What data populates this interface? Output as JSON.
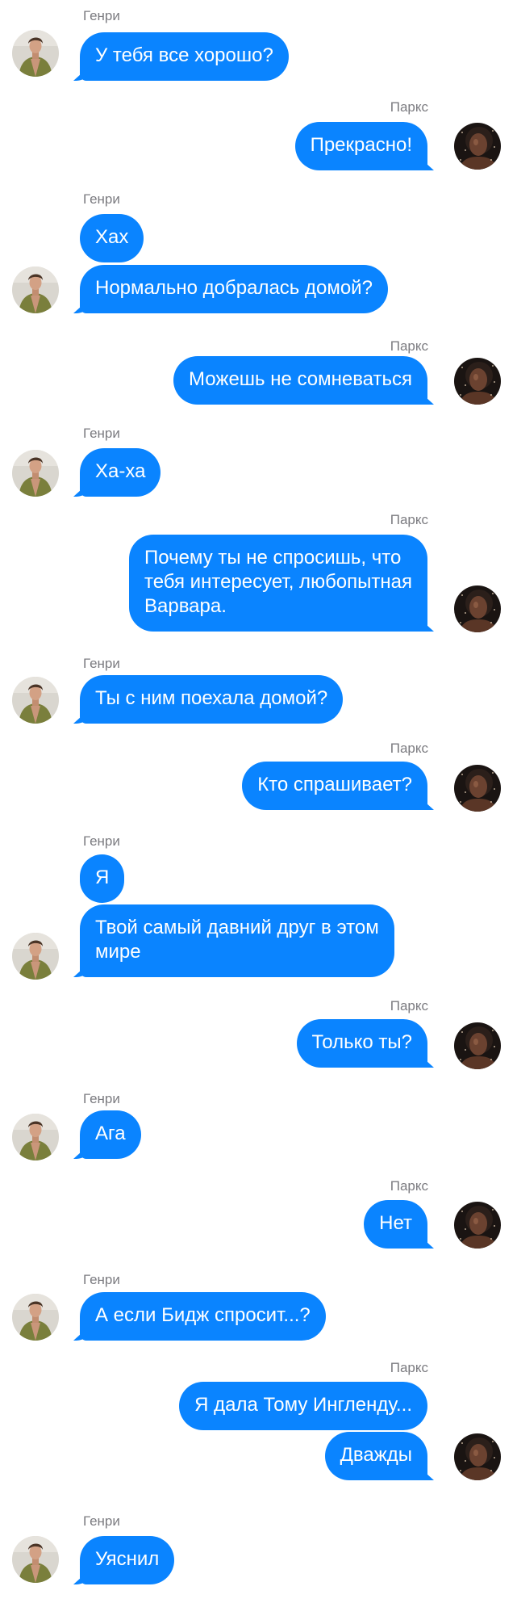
{
  "chat": {
    "messages": [
      {
        "sender": "Генри",
        "side": "left",
        "texts": [
          "У тебя все хорошо?"
        ]
      },
      {
        "sender": "Паркс",
        "side": "right",
        "texts": [
          "Прекрасно!"
        ]
      },
      {
        "sender": "Генри",
        "side": "left",
        "texts": [
          "Хах",
          "Нормально добралась домой?"
        ]
      },
      {
        "sender": "Паркс",
        "side": "right",
        "texts": [
          "Можешь не сомневаться"
        ]
      },
      {
        "sender": "Генри",
        "side": "left",
        "texts": [
          "Ха-ха"
        ]
      },
      {
        "sender": "Паркс",
        "side": "right",
        "texts": [
          "Почему ты не спросишь, что\nтебя интересует, любопытная\nВарвара."
        ]
      },
      {
        "sender": "Генри",
        "side": "left",
        "texts": [
          "Ты с ним поехала домой?"
        ]
      },
      {
        "sender": "Паркс",
        "side": "right",
        "texts": [
          "Кто спрашивает?"
        ]
      },
      {
        "sender": "Генри",
        "side": "left",
        "texts": [
          "Я",
          "Твой самый давний друг в этом\nмире"
        ]
      },
      {
        "sender": "Паркс",
        "side": "right",
        "texts": [
          "Только ты?"
        ]
      },
      {
        "sender": "Генри",
        "side": "left",
        "texts": [
          "Ага"
        ]
      },
      {
        "sender": "Паркс",
        "side": "right",
        "texts": [
          "Нет"
        ]
      },
      {
        "sender": "Генри",
        "side": "left",
        "texts": [
          "А если Бидж спросит...?"
        ]
      },
      {
        "sender": "Паркс",
        "side": "right",
        "texts": [
          "Я дала Тому Ингленду...",
          "Дважды"
        ]
      },
      {
        "sender": "Генри",
        "side": "left",
        "texts": [
          "Уяснил"
        ]
      }
    ]
  },
  "colors": {
    "bubble": "#0a84ff",
    "bubble_text": "#ffffff",
    "sender_name": "#7b7b80",
    "background": "#ffffff"
  },
  "icons": {
    "left_avatar": "henry-avatar-icon",
    "right_avatar": "parks-avatar-icon"
  }
}
